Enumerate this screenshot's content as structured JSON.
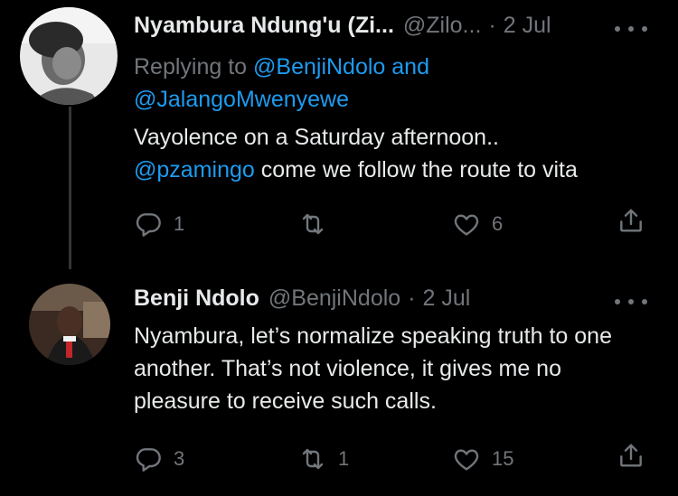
{
  "tweets": [
    {
      "name": "Nyambura Ndung'u (Zi...",
      "handle": "@Zilo...",
      "sep": "·",
      "date": "2 Jul",
      "replying_prefix": "Replying to",
      "replying_user1": "@BenjiNdolo",
      "replying_and": "and",
      "replying_user2": "@JalangoMwenyewe",
      "body_line1": "Vayolence on a Saturday afternoon..",
      "body_mention": "@pzamingo",
      "body_line2_rest": "come we follow the route to vita",
      "reply_count": "1",
      "retweet_count": "",
      "like_count": "6"
    },
    {
      "name": "Benji Ndolo",
      "handle": "@BenjiNdolo",
      "sep": "·",
      "date": "2 Jul",
      "body": "Nyambura, let’s normalize speaking truth to one another. That’s not violence, it gives me no pleasure to receive such calls.",
      "reply_count": "3",
      "retweet_count": "1",
      "like_count": "15"
    }
  ],
  "colors": {
    "background": "#000000",
    "text": "#e7e9ea",
    "muted": "#71767b",
    "link": "#1d9bf0"
  },
  "icons": [
    "reply-icon",
    "retweet-icon",
    "like-icon",
    "share-icon",
    "more-icon"
  ]
}
